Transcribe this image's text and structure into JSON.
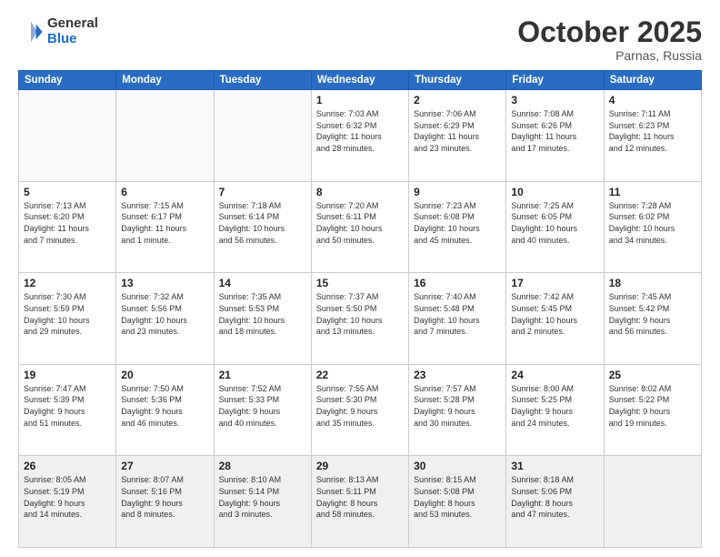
{
  "header": {
    "logo_general": "General",
    "logo_blue": "Blue",
    "month": "October 2025",
    "location": "Parnas, Russia"
  },
  "weekdays": [
    "Sunday",
    "Monday",
    "Tuesday",
    "Wednesday",
    "Thursday",
    "Friday",
    "Saturday"
  ],
  "weeks": [
    [
      {
        "day": "",
        "info": ""
      },
      {
        "day": "",
        "info": ""
      },
      {
        "day": "",
        "info": ""
      },
      {
        "day": "1",
        "info": "Sunrise: 7:03 AM\nSunset: 6:32 PM\nDaylight: 11 hours\nand 28 minutes."
      },
      {
        "day": "2",
        "info": "Sunrise: 7:06 AM\nSunset: 6:29 PM\nDaylight: 11 hours\nand 23 minutes."
      },
      {
        "day": "3",
        "info": "Sunrise: 7:08 AM\nSunset: 6:26 PM\nDaylight: 11 hours\nand 17 minutes."
      },
      {
        "day": "4",
        "info": "Sunrise: 7:11 AM\nSunset: 6:23 PM\nDaylight: 11 hours\nand 12 minutes."
      }
    ],
    [
      {
        "day": "5",
        "info": "Sunrise: 7:13 AM\nSunset: 6:20 PM\nDaylight: 11 hours\nand 7 minutes."
      },
      {
        "day": "6",
        "info": "Sunrise: 7:15 AM\nSunset: 6:17 PM\nDaylight: 11 hours\nand 1 minute."
      },
      {
        "day": "7",
        "info": "Sunrise: 7:18 AM\nSunset: 6:14 PM\nDaylight: 10 hours\nand 56 minutes."
      },
      {
        "day": "8",
        "info": "Sunrise: 7:20 AM\nSunset: 6:11 PM\nDaylight: 10 hours\nand 50 minutes."
      },
      {
        "day": "9",
        "info": "Sunrise: 7:23 AM\nSunset: 6:08 PM\nDaylight: 10 hours\nand 45 minutes."
      },
      {
        "day": "10",
        "info": "Sunrise: 7:25 AM\nSunset: 6:05 PM\nDaylight: 10 hours\nand 40 minutes."
      },
      {
        "day": "11",
        "info": "Sunrise: 7:28 AM\nSunset: 6:02 PM\nDaylight: 10 hours\nand 34 minutes."
      }
    ],
    [
      {
        "day": "12",
        "info": "Sunrise: 7:30 AM\nSunset: 5:59 PM\nDaylight: 10 hours\nand 29 minutes."
      },
      {
        "day": "13",
        "info": "Sunrise: 7:32 AM\nSunset: 5:56 PM\nDaylight: 10 hours\nand 23 minutes."
      },
      {
        "day": "14",
        "info": "Sunrise: 7:35 AM\nSunset: 5:53 PM\nDaylight: 10 hours\nand 18 minutes."
      },
      {
        "day": "15",
        "info": "Sunrise: 7:37 AM\nSunset: 5:50 PM\nDaylight: 10 hours\nand 13 minutes."
      },
      {
        "day": "16",
        "info": "Sunrise: 7:40 AM\nSunset: 5:48 PM\nDaylight: 10 hours\nand 7 minutes."
      },
      {
        "day": "17",
        "info": "Sunrise: 7:42 AM\nSunset: 5:45 PM\nDaylight: 10 hours\nand 2 minutes."
      },
      {
        "day": "18",
        "info": "Sunrise: 7:45 AM\nSunset: 5:42 PM\nDaylight: 9 hours\nand 56 minutes."
      }
    ],
    [
      {
        "day": "19",
        "info": "Sunrise: 7:47 AM\nSunset: 5:39 PM\nDaylight: 9 hours\nand 51 minutes."
      },
      {
        "day": "20",
        "info": "Sunrise: 7:50 AM\nSunset: 5:36 PM\nDaylight: 9 hours\nand 46 minutes."
      },
      {
        "day": "21",
        "info": "Sunrise: 7:52 AM\nSunset: 5:33 PM\nDaylight: 9 hours\nand 40 minutes."
      },
      {
        "day": "22",
        "info": "Sunrise: 7:55 AM\nSunset: 5:30 PM\nDaylight: 9 hours\nand 35 minutes."
      },
      {
        "day": "23",
        "info": "Sunrise: 7:57 AM\nSunset: 5:28 PM\nDaylight: 9 hours\nand 30 minutes."
      },
      {
        "day": "24",
        "info": "Sunrise: 8:00 AM\nSunset: 5:25 PM\nDaylight: 9 hours\nand 24 minutes."
      },
      {
        "day": "25",
        "info": "Sunrise: 8:02 AM\nSunset: 5:22 PM\nDaylight: 9 hours\nand 19 minutes."
      }
    ],
    [
      {
        "day": "26",
        "info": "Sunrise: 8:05 AM\nSunset: 5:19 PM\nDaylight: 9 hours\nand 14 minutes."
      },
      {
        "day": "27",
        "info": "Sunrise: 8:07 AM\nSunset: 5:16 PM\nDaylight: 9 hours\nand 8 minutes."
      },
      {
        "day": "28",
        "info": "Sunrise: 8:10 AM\nSunset: 5:14 PM\nDaylight: 9 hours\nand 3 minutes."
      },
      {
        "day": "29",
        "info": "Sunrise: 8:13 AM\nSunset: 5:11 PM\nDaylight: 8 hours\nand 58 minutes."
      },
      {
        "day": "30",
        "info": "Sunrise: 8:15 AM\nSunset: 5:08 PM\nDaylight: 8 hours\nand 53 minutes."
      },
      {
        "day": "31",
        "info": "Sunrise: 8:18 AM\nSunset: 5:06 PM\nDaylight: 8 hours\nand 47 minutes."
      },
      {
        "day": "",
        "info": ""
      }
    ]
  ]
}
